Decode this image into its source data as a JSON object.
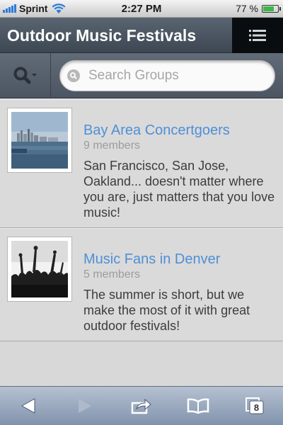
{
  "status_bar": {
    "carrier": "Sprint",
    "time": "2:27 PM",
    "battery": "77 %",
    "battery_level": 0.77
  },
  "header": {
    "title": "Outdoor Music Festivals",
    "menu_icon": "list-icon"
  },
  "search": {
    "type_icon": "search-icon",
    "placeholder": "Search Groups",
    "value": ""
  },
  "groups": [
    {
      "name": "Bay Area Concertgoers",
      "members": "9 members",
      "description": "San Francisco, San Jose, Oakland... doesn't matter where you are, just matters that you love music!",
      "image": "city-skyline-photo"
    },
    {
      "name": "Music Fans in Denver",
      "members": "5 members",
      "description": "The summer is short, but we make the most of it with great outdoor festivals!",
      "image": "concert-crowd-photo"
    }
  ],
  "toolbar": {
    "icons": [
      "back-icon",
      "forward-icon",
      "share-icon",
      "bookmarks-icon",
      "tabs-icon"
    ],
    "tabs_count": "8"
  },
  "colors": {
    "header_bg": "#4a545f",
    "link": "#4f8fd6",
    "toolbar_bg": "#9aa8bd"
  }
}
